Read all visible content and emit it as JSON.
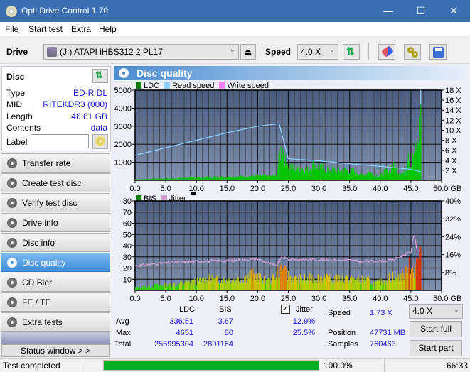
{
  "window": {
    "title": "Opti Drive Control 1.70",
    "minimize": "—",
    "maximize": "☐",
    "close": "✕"
  },
  "menu": [
    "File",
    "Start test",
    "Extra",
    "Help"
  ],
  "toolbar": {
    "drive_label": "Drive",
    "drive_value": "(J:)  ATAPI iHBS312  2 PL17",
    "speed_label": "Speed",
    "speed_value": "4.0 X"
  },
  "disc": {
    "header": "Disc",
    "rows": [
      {
        "key": "Type",
        "value": "BD-R DL"
      },
      {
        "key": "MID",
        "value": "RITEKDR3 (000)"
      },
      {
        "key": "Length",
        "value": "46.61 GB"
      },
      {
        "key": "Contents",
        "value": "data"
      }
    ],
    "label_key": "Label",
    "label_value": ""
  },
  "nav": [
    {
      "label": "Transfer rate",
      "active": false
    },
    {
      "label": "Create test disc",
      "active": false
    },
    {
      "label": "Verify test disc",
      "active": false
    },
    {
      "label": "Drive info",
      "active": false
    },
    {
      "label": "Disc info",
      "active": false
    },
    {
      "label": "Disc quality",
      "active": true
    },
    {
      "label": "CD Bler",
      "active": false
    },
    {
      "label": "FE / TE",
      "active": false
    },
    {
      "label": "Extra tests",
      "active": false
    }
  ],
  "status_window_button": "Status window > >",
  "panel_title": "Disc quality",
  "colors": {
    "ldc": "#008000",
    "read_speed": "#87cefa",
    "write_speed": "#ff80ff",
    "bis": "#008000",
    "jitter": "#d8a0d8",
    "plot_bg_top": "#4c5c80",
    "plot_bg_bottom": "#8090b0",
    "accent": "#3c8ee0"
  },
  "chart_data": [
    {
      "type": "area",
      "title": "LDC / Read speed",
      "legend": [
        "LDC",
        "Read speed",
        "Write speed"
      ],
      "xlabel": "GB",
      "x_ticks": [
        "0.0",
        "5.0",
        "10.0",
        "15.0",
        "20.0",
        "25.0",
        "30.0",
        "35.0",
        "40.0",
        "45.0",
        "50.0 GB"
      ],
      "y_left_ticks": [
        "1000",
        "2000",
        "3000",
        "4000",
        "5000"
      ],
      "y_right_ticks": [
        "2 X",
        "4 X",
        "6 X",
        "8 X",
        "10 X",
        "12 X",
        "14 X",
        "16 X",
        "18 X"
      ],
      "xlim": [
        0,
        50
      ],
      "ylim": [
        0,
        5000
      ],
      "y2lim": [
        0,
        18
      ],
      "series": [
        {
          "name": "LDC",
          "x": [
            0,
            1,
            2,
            3,
            4,
            5,
            6,
            7,
            8,
            9,
            10,
            11,
            12,
            13,
            14,
            15,
            16,
            17,
            18,
            19,
            20,
            21,
            22,
            23,
            23.5,
            24,
            24.5,
            25,
            26,
            27,
            28,
            29,
            30,
            31,
            32,
            33,
            34,
            35,
            36,
            37,
            38,
            39,
            40,
            41,
            42,
            43,
            44,
            44.5,
            45,
            45.5,
            46,
            46.3,
            46.6
          ],
          "values": [
            60,
            70,
            80,
            90,
            100,
            110,
            120,
            130,
            140,
            150,
            160,
            170,
            180,
            200,
            190,
            210,
            230,
            220,
            250,
            260,
            280,
            270,
            250,
            260,
            1500,
            2000,
            1100,
            900,
            700,
            750,
            600,
            950,
            800,
            700,
            650,
            600,
            620,
            580,
            550,
            300,
            500,
            350,
            300,
            600,
            850,
            500,
            400,
            1900,
            900,
            1700,
            2200,
            3000,
            4651
          ]
        },
        {
          "name": "Read speed",
          "x": [
            0,
            5,
            10,
            15,
            20,
            23.5,
            25,
            30,
            35,
            40,
            45,
            46.6
          ],
          "values": [
            5.0,
            6.5,
            8.0,
            9.5,
            10.8,
            11.3,
            4.3,
            3.9,
            3.3,
            2.8,
            2.2,
            1.73
          ]
        }
      ]
    },
    {
      "type": "area",
      "title": "BIS / Jitter",
      "legend": [
        "BIS",
        "Jitter"
      ],
      "xlabel": "GB",
      "x_ticks": [
        "0.0",
        "5.0",
        "10.0",
        "15.0",
        "20.0",
        "25.0",
        "30.0",
        "35.0",
        "40.0",
        "45.0",
        "50.0 GB"
      ],
      "y_left_ticks": [
        "10",
        "20",
        "30",
        "40",
        "50",
        "60",
        "70",
        "80"
      ],
      "y_right_ticks": [
        "8%",
        "16%",
        "24%",
        "32%",
        "40%"
      ],
      "xlim": [
        0,
        50
      ],
      "ylim": [
        0,
        80
      ],
      "y2lim": [
        0,
        40
      ],
      "series": [
        {
          "name": "BIS",
          "x": [
            0,
            2,
            4,
            6,
            8,
            10,
            12,
            14,
            16,
            18,
            19,
            20,
            22,
            23.5,
            24,
            25,
            26,
            28,
            30,
            32,
            34,
            36,
            38,
            39,
            40,
            41,
            42,
            43,
            44,
            44.5,
            45,
            45.5,
            46,
            46.3,
            46.6
          ],
          "values": [
            3,
            4,
            5,
            6,
            7,
            9,
            11,
            10,
            11,
            12,
            16,
            13,
            9,
            22,
            20,
            14,
            11,
            12,
            13,
            11,
            12,
            11,
            10,
            7,
            8,
            11,
            15,
            13,
            16,
            30,
            25,
            12,
            28,
            40,
            80
          ]
        },
        {
          "name": "Jitter",
          "x": [
            0,
            5,
            10,
            15,
            20,
            23,
            24,
            25,
            30,
            35,
            37,
            40,
            42,
            44,
            45,
            45.5,
            46,
            46.6
          ],
          "values": [
            11.0,
            12.3,
            13.0,
            13.3,
            14.0,
            11.0,
            14.8,
            13.8,
            13.7,
            13.5,
            12.9,
            13.2,
            13.5,
            16.0,
            17.0,
            25.5,
            18.0,
            17.5
          ]
        }
      ]
    }
  ],
  "stats": {
    "col_ldc": "LDC",
    "col_bis": "BIS",
    "jitter_checked": true,
    "jitter_label": "Jitter",
    "rows": [
      {
        "label": "Avg",
        "ldc": "336.51",
        "bis": "3.67",
        "jitter": "12.9%"
      },
      {
        "label": "Max",
        "ldc": "4651",
        "bis": "80",
        "jitter": "25.5%"
      },
      {
        "label": "Total",
        "ldc": "256995304",
        "bis": "2801164",
        "jitter": ""
      }
    ],
    "speed_label": "Speed",
    "speed_value": "1.73 X",
    "position_label": "Position",
    "position_value": "47731 MB",
    "samples_label": "Samples",
    "samples_value": "760463",
    "speed_select": "4.0 X",
    "start_full": "Start full",
    "start_part": "Start part"
  },
  "status": {
    "text": "Test completed",
    "progress": 100.0,
    "progress_label": "100.0%",
    "time": "66:33"
  }
}
